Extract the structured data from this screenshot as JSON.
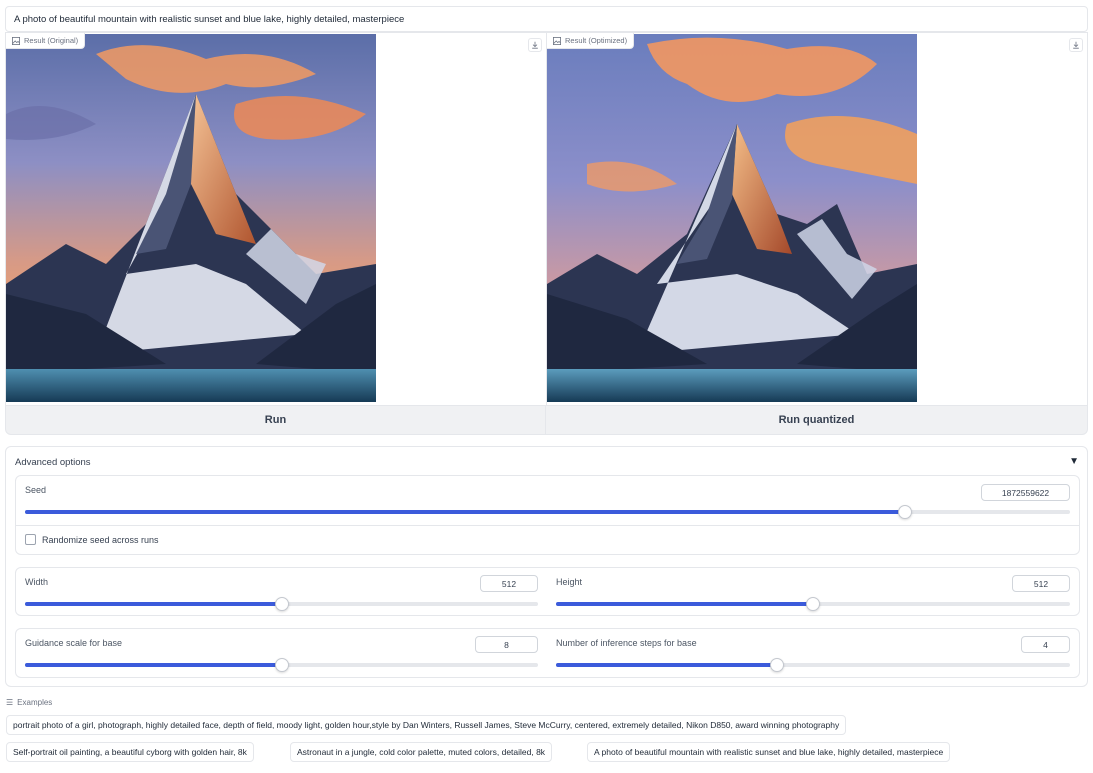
{
  "prompt": {
    "value": "A photo of beautiful mountain with realistic sunset and blue lake, highly detailed, masterpiece"
  },
  "results": {
    "original_label": "Result (Original)",
    "optimized_label": "Result (Optimized)"
  },
  "buttons": {
    "run": "Run",
    "run_quantized": "Run quantized"
  },
  "advanced": {
    "title": "Advanced options",
    "seed": {
      "label": "Seed",
      "value": "1872559622",
      "fraction": 0.8425
    },
    "randomize_label": "Randomize seed across runs",
    "randomize_checked": false,
    "width": {
      "label": "Width",
      "value": "512",
      "fraction": 0.5
    },
    "height": {
      "label": "Height",
      "value": "512",
      "fraction": 0.5
    },
    "guidance": {
      "label": "Guidance scale for base",
      "value": "8",
      "fraction": 0.5
    },
    "steps": {
      "label": "Number of inference steps for base",
      "value": "4",
      "fraction": 0.43
    }
  },
  "examples": {
    "title": "Examples",
    "items": [
      "portrait photo of a girl, photograph, highly detailed face, depth of field, moody light, golden hour,style by Dan Winters, Russell James, Steve McCurry, centered, extremely detailed, Nikon D850, award winning photography",
      "Self-portrait oil painting, a beautiful cyborg with golden hair, 8k",
      "Astronaut in a jungle, cold color palette, muted colors, detailed, 8k",
      "A photo of beautiful mountain with realistic sunset and blue lake, highly detailed, masterpiece"
    ]
  },
  "colors": {
    "accent": "#3b5bdb",
    "border": "#e5e7eb",
    "button_bg": "#f0f1f3"
  },
  "icons": {
    "image": "image-icon",
    "download": "download-icon",
    "collapse": "triangle-down-icon",
    "list": "list-icon"
  }
}
